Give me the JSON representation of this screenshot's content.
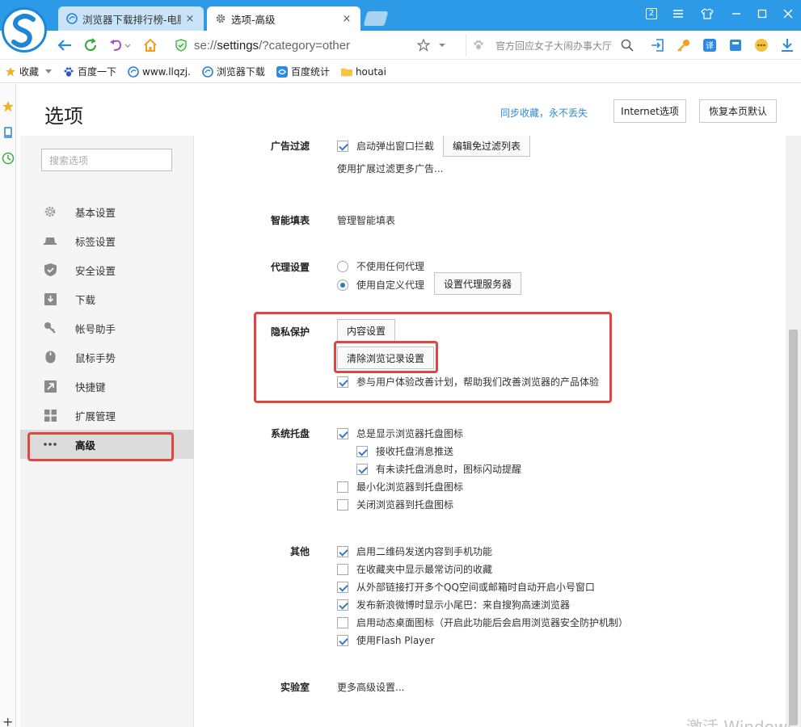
{
  "browser": {
    "tabs": [
      {
        "label": "浏览器下载排行榜-电脑",
        "close": "×"
      },
      {
        "label": "选项-高级",
        "close": "×"
      }
    ],
    "window_controls": {
      "badge": "2"
    },
    "address": {
      "prefix": "se://",
      "highlight": "settings",
      "suffix": "/?category=other"
    },
    "search": {
      "text": "官方回应女子大闹办事大厅"
    },
    "bookmarks": [
      "收藏",
      "百度一下",
      "www.llqzj.",
      "浏览器下载",
      "百度统计",
      "houtai"
    ]
  },
  "page": {
    "title": "选项",
    "sync_link": "同步收藏，永不丢失",
    "internet_options": "Internet选项",
    "restore_default": "恢复本页默认"
  },
  "sidebar": {
    "search_placeholder": "搜索选项",
    "items": [
      {
        "label": "基本设置",
        "icon": "gear-icon"
      },
      {
        "label": "标签设置",
        "icon": "tab-icon"
      },
      {
        "label": "安全设置",
        "icon": "shield-icon"
      },
      {
        "label": "下载",
        "icon": "download-icon"
      },
      {
        "label": "帐号助手",
        "icon": "key-icon"
      },
      {
        "label": "鼠标手势",
        "icon": "mouse-icon"
      },
      {
        "label": "快捷键",
        "icon": "shortcut-icon"
      },
      {
        "label": "扩展管理",
        "icon": "extensions-icon"
      },
      {
        "label": "高级",
        "icon": "more-icon",
        "active": true
      }
    ]
  },
  "settings": {
    "adblock": {
      "label": "广告过滤",
      "popup_block": "启动弹出窗口拦截",
      "edit_list": "编辑免过滤列表",
      "more": "使用扩展过滤更多广告..."
    },
    "autofill": {
      "label": "智能填表",
      "manage": "管理智能填表"
    },
    "proxy": {
      "label": "代理设置",
      "none": "不使用任何代理",
      "custom": "使用自定义代理",
      "set_server": "设置代理服务器"
    },
    "privacy": {
      "label": "隐私保护",
      "content_settings": "内容设置",
      "clear_history": "清除浏览记录设置",
      "ux_plan": "参与用户体验改善计划，帮助我们改善浏览器的产品体验"
    },
    "tray": {
      "label": "系统托盘",
      "always_show": "总是显示浏览器托盘图标",
      "receive_push": "接收托盘消息推送",
      "flash_unread": "有未读托盘消息时，图标闪动提醒",
      "minimize_to_tray": "最小化浏览器到托盘图标",
      "close_to_tray": "关闭浏览器到托盘图标"
    },
    "other": {
      "label": "其他",
      "qr_send": "启用二维码发送内容到手机功能",
      "show_frequent": "在收藏夹中显示最常访问的收藏",
      "qq_small_window": "从外部链接打开多个QQ空间或邮箱时自动开启小号窗口",
      "weibo_tail": "发布新浪微博时显示小尾巴：来自搜狗高速浏览器",
      "dynamic_icon": "启用动态桌面图标（开启此功能后会启用浏览器安全防护机制）",
      "flash_player": "使用Flash Player"
    },
    "lab": {
      "label": "实验室",
      "more": "更多高级设置..."
    }
  },
  "watermark": "激活 Windows",
  "colors": {
    "accent": "#2c9ae6",
    "highlight_box": "#e0463f",
    "link": "#2d8ad6"
  }
}
